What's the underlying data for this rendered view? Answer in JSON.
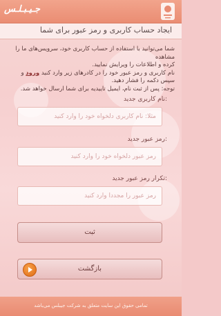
{
  "header": {
    "logo_text": "جـيـبـلـس",
    "emblem": "seal-emblem-icon"
  },
  "title": "ایجاد حساب کاربری و رمز عبور برای شما",
  "info": {
    "line1": "شما می‌توانید با استفاده از حساب کاربری خود، سرویس‌های ما را مشاهده",
    "line2": "کرده و اطلاعات را ویرایش نمایید.",
    "line3": "نام کاربری و رمز عبور خود را در کادرهای زیر وارد کنید",
    "highlight": "ورود",
    "line4": "و سپس دکمه را فشار دهید.",
    "line5": "توجه: پس از ثبت نام، ایمیل تاییدیه برای شما ارسال خواهد شد."
  },
  "fields": {
    "username": {
      "label": "نام کاربری جدید:",
      "placeholder": "مثلا: نام کاربری دلخواه خود را وارد کنید"
    },
    "password": {
      "label": "رمز عبور جدید:",
      "placeholder": "رمز عبور دلخواه خود را وارد کنید"
    },
    "confirm": {
      "label": "تکرار رمز عبور جدید:",
      "placeholder": "رمز عبور را مجددا وارد کنید"
    }
  },
  "buttons": {
    "submit": "ثبت",
    "back": "بازگشت"
  },
  "footer": {
    "text": "تمامی حقوق این سایت متعلق به شرکت جیبلس می‌باشد"
  }
}
